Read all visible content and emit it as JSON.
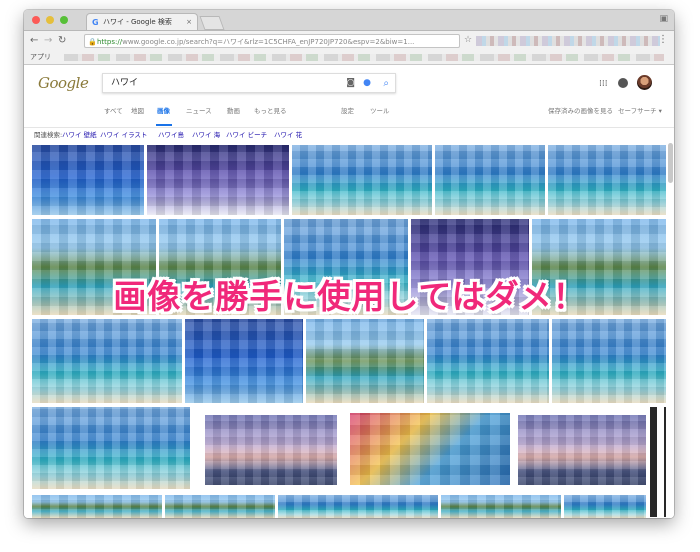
{
  "browser": {
    "tab_title": "ハワイ - Google 検索",
    "tab_close": "×",
    "url_prefix": "https://",
    "url_rest": "www.google.co.jp/search?q=ハワイ&rlz=1C5CHFA_enJP720JP720&espv=2&biw=1...",
    "bookmark_apps_label": "アプリ"
  },
  "google": {
    "logo_text": "Google",
    "search_query": "ハワイ",
    "tabs": [
      "すべて",
      "地図",
      "画像",
      "ニュース",
      "動画",
      "もっと見る",
      "設定",
      "ツール"
    ],
    "active_tab": "画像",
    "right_tools": [
      "保存済みの画像を見る",
      "セーフサーチ ▾"
    ]
  },
  "related": {
    "label": "関連検索:",
    "links": [
      "ハワイ 壁紙",
      "ハワイ イラスト",
      "ハワイ島",
      "ハワイ 海",
      "ハワイ ビーチ",
      "ハワイ 花"
    ]
  },
  "overlay_text": "画像を勝手に使用してはダメ！",
  "icons": [
    "close-dot-icon",
    "minimize-dot-icon",
    "zoom-dot-icon",
    "back-icon",
    "forward-icon",
    "reload-icon",
    "lock-icon",
    "star-icon",
    "menu-icon",
    "camera-icon",
    "mic-icon",
    "search-icon",
    "apps-grid-icon",
    "notifications-icon",
    "avatar"
  ],
  "colors": {
    "overlay": "#f0287a",
    "link_active": "#1a73e8",
    "related_link": "#1a0dab"
  }
}
